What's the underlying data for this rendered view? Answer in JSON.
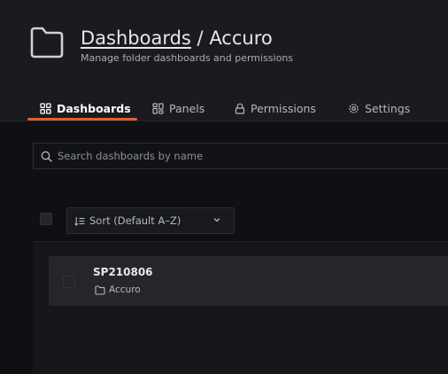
{
  "header": {
    "section_link": "Dashboards",
    "separator": " / ",
    "folder_name": "Accuro",
    "subtitle": "Manage folder dashboards and permissions"
  },
  "tabs": [
    {
      "label": "Dashboards",
      "icon": "apps-icon",
      "active": true
    },
    {
      "label": "Panels",
      "icon": "panels-icon",
      "active": false
    },
    {
      "label": "Permissions",
      "icon": "lock-icon",
      "active": false
    },
    {
      "label": "Settings",
      "icon": "gear-icon",
      "active": false
    }
  ],
  "search": {
    "placeholder": "Search dashboards by name",
    "value": ""
  },
  "sort": {
    "label": "Sort (Default A–Z)"
  },
  "dashboards": [
    {
      "title": "SP210806",
      "folder": "Accuro"
    }
  ],
  "colors": {
    "accent": "#f05a28",
    "background": "#0f1013",
    "panel": "#1a1b1f"
  }
}
